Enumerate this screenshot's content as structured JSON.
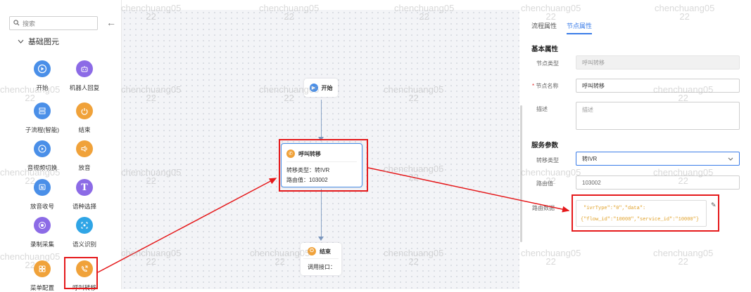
{
  "sidebar": {
    "search_placeholder": "搜索",
    "group_title": "基础图元",
    "items": [
      {
        "label": "开始",
        "icon": "play-icon",
        "color": "#4a8fe8"
      },
      {
        "label": "机器人回复",
        "icon": "robot-icon",
        "color": "#8c6be6"
      },
      {
        "label": "子流程(智能)",
        "icon": "subflow-icon",
        "color": "#4a8fe8"
      },
      {
        "label": "结束",
        "icon": "power-icon",
        "color": "#f0a23a"
      },
      {
        "label": "音视频切换",
        "icon": "av-switch-icon",
        "color": "#4a8fe8"
      },
      {
        "label": "放音",
        "icon": "speaker-icon",
        "color": "#f0a23a"
      },
      {
        "label": "放音收号",
        "icon": "digit-collect-icon",
        "color": "#4a8fe8"
      },
      {
        "label": "语种选择",
        "icon": "language-icon",
        "color": "#8c6be6"
      },
      {
        "label": "录制采集",
        "icon": "record-icon",
        "color": "#8c6be6"
      },
      {
        "label": "语义识别",
        "icon": "semantic-icon",
        "color": "#2fa5e6"
      },
      {
        "label": "菜单配置",
        "icon": "menu-config-icon",
        "color": "#f0a23a"
      },
      {
        "label": "呼叫转移",
        "icon": "call-transfer-icon",
        "color": "#f0a23a"
      }
    ]
  },
  "canvas": {
    "start_node": {
      "label": "开始"
    },
    "transfer_node": {
      "title": "呼叫转移",
      "type_label": "转移类型：",
      "type_value": "转IVR",
      "route_label": "路由值：",
      "route_value": "103002"
    },
    "end_node": {
      "title": "结束",
      "detail": "调用接口："
    }
  },
  "panel": {
    "tabs": [
      "流程属性",
      "节点属性"
    ],
    "active_tab": "节点属性",
    "basic_title": "基本属性",
    "node_type_label": "节点类型",
    "node_type_value": "呼叫转移",
    "node_name_required": "*",
    "node_name_label": "节点名称",
    "node_name_value": "呼叫转移",
    "desc_label": "描述",
    "desc_placeholder": "描述",
    "service_title": "服务参数",
    "transfer_type_label": "转移类型",
    "transfer_type_value": "转IVR",
    "route_label": "路由值",
    "route_value": "103002",
    "route_data_label": "路由数据",
    "route_data_line1": "\"ivrType\":\"0\",\"data\":",
    "route_data_line2": "{\"flow_id\":\"10008\",\"service_id\":\"10000\"}"
  },
  "watermark": {
    "name": "chenchuang05",
    "num": "22"
  },
  "colors": {
    "accent": "#3a7ce8",
    "callout": "#e5191b",
    "code": "#e0a12a"
  }
}
